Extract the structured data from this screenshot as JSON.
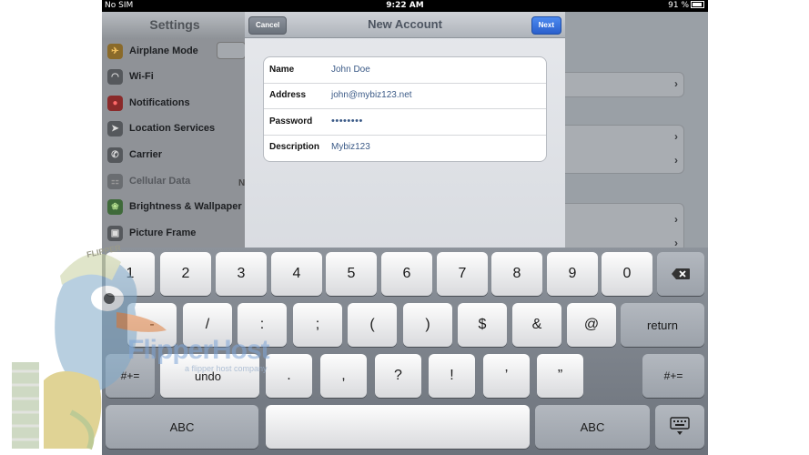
{
  "status_bar": {
    "carrier": "No SIM",
    "time": "9:22 AM",
    "battery": "91 %"
  },
  "settings": {
    "title": "Settings",
    "items": [
      {
        "label": "Airplane Mode",
        "icon": "airplane-icon"
      },
      {
        "label": "Wi-Fi",
        "icon": "wifi-icon"
      },
      {
        "label": "Notifications",
        "icon": "notifications-icon"
      },
      {
        "label": "Location Services",
        "icon": "location-icon"
      },
      {
        "label": "Carrier",
        "icon": "carrier-icon"
      },
      {
        "label": "Cellular Data",
        "icon": "cellular-icon",
        "partial": "N"
      },
      {
        "label": "Brightness & Wallpaper",
        "icon": "brightness-icon"
      },
      {
        "label": "Picture Frame",
        "icon": "picture-frame-icon"
      }
    ]
  },
  "modal": {
    "title": "New Account",
    "cancel_label": "Cancel",
    "next_label": "Next",
    "fields": [
      {
        "label": "Name",
        "value": "John Doe"
      },
      {
        "label": "Address",
        "value": "john@mybiz123.net"
      },
      {
        "label": "Password",
        "value": "••••••••"
      },
      {
        "label": "Description",
        "value": "Mybiz123"
      }
    ]
  },
  "keyboard": {
    "row1": [
      "1",
      "2",
      "3",
      "4",
      "5",
      "6",
      "7",
      "8",
      "9",
      "0"
    ],
    "delete_icon": "backspace-icon",
    "row2": [
      "-",
      "/",
      ":",
      ";",
      "(",
      ")",
      "$",
      "&",
      "@"
    ],
    "return_label": "return",
    "row3_left": "#+=",
    "undo_label": "undo",
    "row3": [
      ".",
      ",",
      "?",
      "!",
      "’",
      "”"
    ],
    "row3_right": "#+=",
    "abc_label": "ABC",
    "hide_keyboard_icon": "keyboard-icon"
  },
  "watermark": {
    "logo": "FlipperHost",
    "tagline": "a flipper host company"
  },
  "colors": {
    "next_button": "#2a5fcc",
    "field_value": "#3b5a87"
  }
}
